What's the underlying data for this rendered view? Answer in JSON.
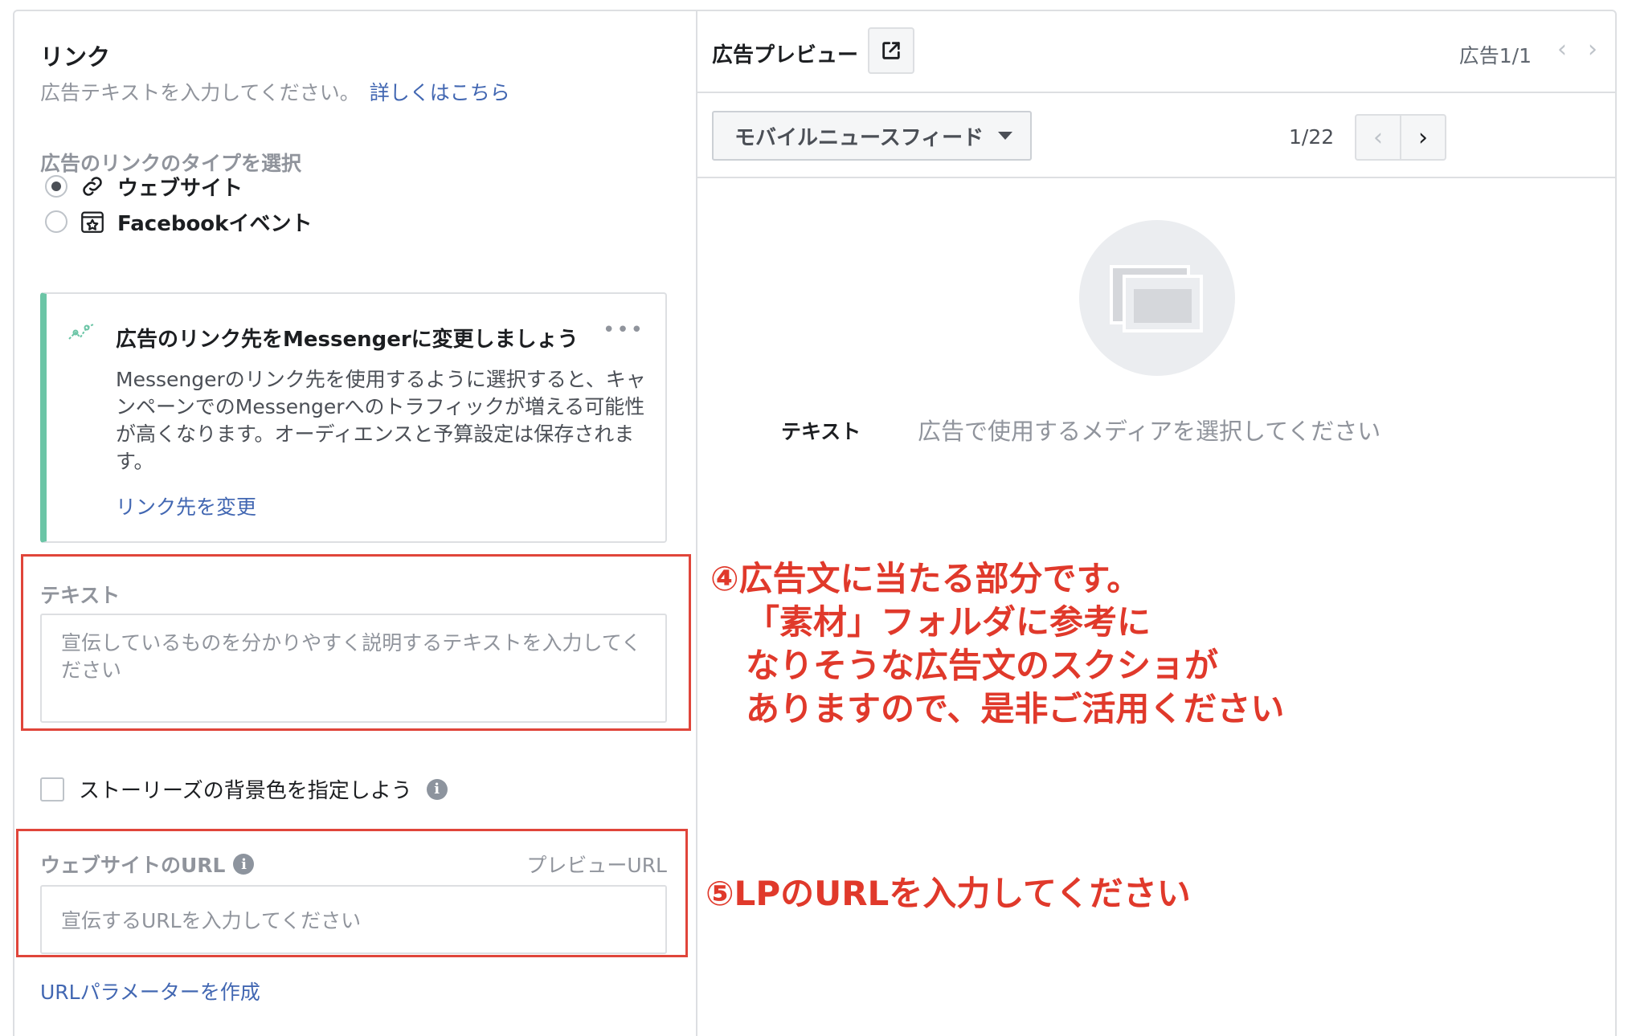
{
  "link_section": {
    "title": "リンク",
    "subtitle": "広告テキストを入力してください。",
    "learn_more": "詳しくはこちら",
    "link_type_label": "広告のリンクのタイプを選択",
    "options": [
      {
        "label": "ウェブサイト",
        "selected": true
      },
      {
        "label": "Facebookイベント",
        "selected": false
      }
    ]
  },
  "messenger_card": {
    "title": "広告のリンク先をMessengerに変更しましょう",
    "body": "Messengerのリンク先を使用するように選択すると、キャンペーンでのMessengerへのトラフィックが増える可能性が高くなります。オーディエンスと予算設定は保存されます。",
    "link": "リンク先を変更",
    "accent_color": "#6bc5a6"
  },
  "text_field": {
    "label": "テキスト",
    "placeholder": "宣伝しているものを分かりやすく説明するテキストを入力してください"
  },
  "story_bg": {
    "label": "ストーリーズの背景色を指定しよう",
    "checked": false
  },
  "url_field": {
    "label": "ウェブサイトのURL",
    "preview_label": "プレビューURL",
    "placeholder": "宣伝するURLを入力してください",
    "param_link": "URLパラメーターを作成"
  },
  "annotations": {
    "note4_lines": [
      "④広告文に当たる部分です。",
      "「素材」フォルダに参考に",
      "なりそうな広告文のスクショが",
      "ありますので、是非ご活用ください"
    ],
    "note5": "⑤LPのURLを入力してください",
    "color": "#e0392b"
  },
  "preview": {
    "title": "広告プレビュー",
    "ad_count": "広告1/1",
    "placement": "モバイルニュースフィード",
    "page_count": "1/22",
    "text_label": "テキスト",
    "media_hint": "広告で使用するメディアを選択してください"
  },
  "colors": {
    "link": "#4267b2",
    "border": "#dddfe2",
    "muted": "#90949c"
  }
}
